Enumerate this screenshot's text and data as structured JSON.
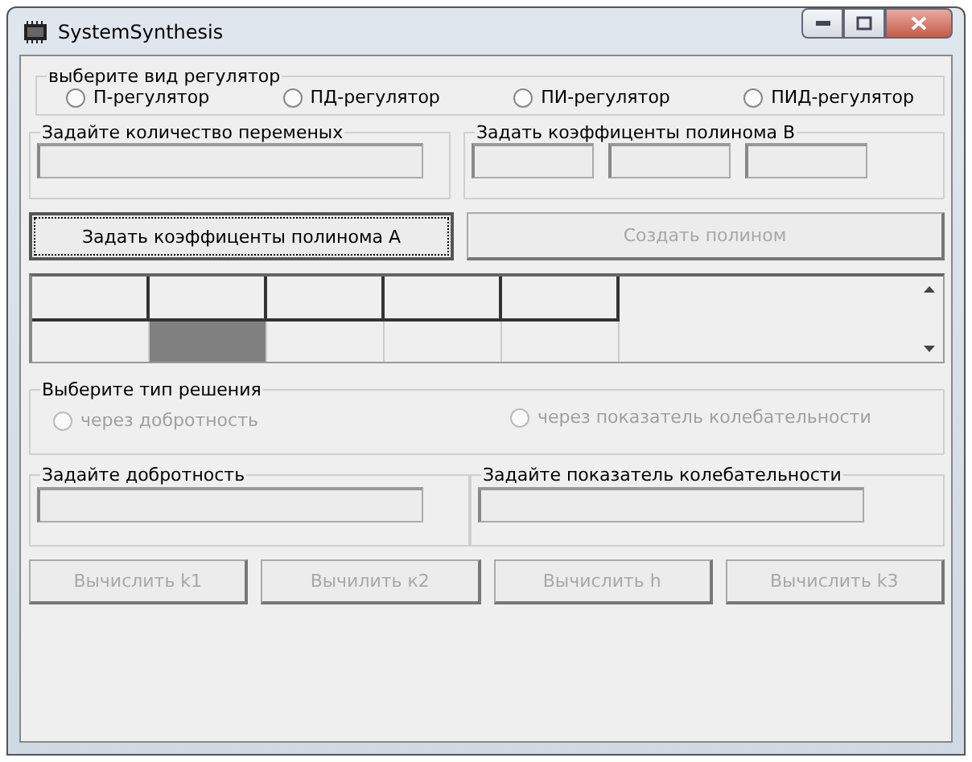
{
  "window": {
    "title": "SystemSynthesis"
  },
  "regulator_group": {
    "title": "выберите вид регулятор",
    "options": [
      {
        "label": "П-регулятор",
        "selected": false,
        "disabled": false
      },
      {
        "label": "ПД-регулятор",
        "selected": false,
        "disabled": false
      },
      {
        "label": "ПИ-регулятор",
        "selected": false,
        "disabled": false
      },
      {
        "label": "ПИД-регулятор",
        "selected": false,
        "disabled": false
      }
    ]
  },
  "variables_group": {
    "title": "Задайте количество переменых"
  },
  "poly_b_group": {
    "title": "Задать коэффиценты полинома В"
  },
  "buttons_top": [
    {
      "label": "Задать коэффиценты полинома А",
      "disabled": false,
      "focused": true
    },
    {
      "label": "Создать полином",
      "disabled": true,
      "focused": false
    }
  ],
  "grid": {
    "rows": [
      {
        "kind": "header",
        "cells": [
          {
            "selected": false
          },
          {
            "selected": false
          },
          {
            "selected": false
          },
          {
            "selected": false
          },
          {
            "selected": false
          }
        ]
      },
      {
        "kind": "data",
        "cells": [
          {
            "selected": false
          },
          {
            "selected": true
          },
          {
            "selected": false
          },
          {
            "selected": false
          },
          {
            "selected": false
          }
        ]
      }
    ]
  },
  "solution_group": {
    "title": "Выберите тип решения",
    "options": [
      {
        "label": "через добротность",
        "selected": false,
        "disabled": true
      },
      {
        "label": "через показатель колебательности",
        "selected": false,
        "disabled": true
      }
    ]
  },
  "quality_group": {
    "title": "Задайте добротность"
  },
  "oscillation_group": {
    "title": "Задайте показатель колебательности"
  },
  "buttons_bottom": [
    {
      "label": "Вычислить k1",
      "disabled": true
    },
    {
      "label": "Вычилить к2",
      "disabled": true
    },
    {
      "label": "Вычислить h",
      "disabled": true
    },
    {
      "label": "Вычислить k3",
      "disabled": true
    }
  ]
}
